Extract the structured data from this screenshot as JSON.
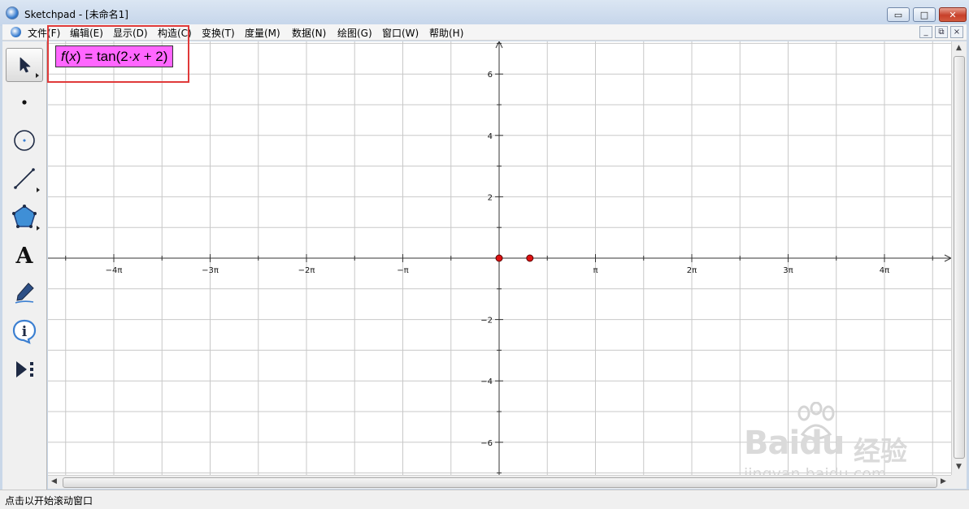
{
  "window": {
    "app_name": "Sketchpad",
    "doc_title": " - [未命名1]",
    "minimize_glyph": "▭",
    "maximize_glyph": "□",
    "close_glyph": "✕"
  },
  "menu": {
    "items": [
      "文件(F)",
      "编辑(E)",
      "显示(D)",
      "构造(C)",
      "变换(T)",
      "度量(M)",
      "数据(N)",
      "绘图(G)",
      "窗口(W)",
      "帮助(H)"
    ],
    "mdi_min": "_",
    "mdi_restore": "⧉",
    "mdi_close": "×"
  },
  "toolbox": {
    "tools": [
      "arrow-select-icon",
      "point-icon",
      "compass-icon",
      "straightedge-icon",
      "polygon-icon",
      "text-icon",
      "marker-icon",
      "information-icon",
      "custom-tool-icon"
    ],
    "active_tool": "arrow-select-icon"
  },
  "function_label": {
    "fname": "f",
    "arg": "x",
    "expr_prefix": " = tan(2·",
    "expr_var": "x",
    "expr_suffix": " + 2)"
  },
  "graph": {
    "x_ticks": [
      "−4π",
      "−3π",
      "−2π",
      "−π",
      "π",
      "2π",
      "3π",
      "4π"
    ],
    "y_ticks": [
      "6",
      "4",
      "2",
      "−2",
      "−4",
      "−6"
    ],
    "y_tick_values": [
      6,
      4,
      2,
      -2,
      -4,
      -6
    ],
    "x_tick_values": [
      -4,
      -3,
      -2,
      -1,
      1,
      2,
      3,
      4
    ],
    "x_unit": "π",
    "points": [
      {
        "x": 0,
        "y": 0,
        "color": "#dd1111"
      },
      {
        "x": 1,
        "y": 0,
        "color": "#dd1111"
      }
    ],
    "grid": true,
    "axis_color": "#333333",
    "grid_color": "#c8c8c8"
  },
  "statusbar": {
    "text": "点击以开始滚动窗口"
  },
  "watermark": {
    "logo": "Baidu",
    "cn": "经验",
    "url": "jingyan.baidu.com"
  }
}
